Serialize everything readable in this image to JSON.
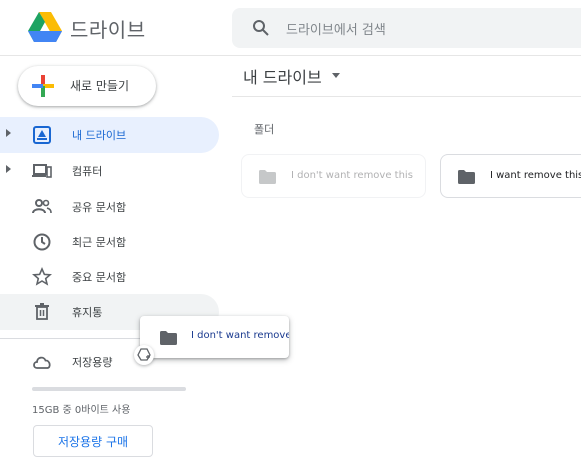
{
  "app": {
    "title": "드라이브"
  },
  "search": {
    "placeholder": "드라이브에서 검색"
  },
  "sidebar": {
    "new_label": "새로 만들기",
    "items": [
      {
        "label": "내 드라이브",
        "icon": "my-drive-icon",
        "active": true,
        "expandable": true
      },
      {
        "label": "컴퓨터",
        "icon": "computer-icon",
        "active": false,
        "expandable": true
      },
      {
        "label": "공유 문서함",
        "icon": "shared-people-icon",
        "active": false
      },
      {
        "label": "최근 문서함",
        "icon": "clock-icon",
        "active": false
      },
      {
        "label": "중요 문서함",
        "icon": "star-icon",
        "active": false
      },
      {
        "label": "휴지통",
        "icon": "trash-icon",
        "active": false,
        "hover": true
      }
    ],
    "storage": {
      "label": "저장용량",
      "usage_text": "15GB 중 0바이트 사용",
      "used_fraction": 0.0,
      "buy_label": "저장용량 구매"
    }
  },
  "main": {
    "title": "내 드라이브",
    "section_label": "폴더",
    "folders": [
      {
        "name": "I don't want remove this",
        "state": "dragging-source"
      },
      {
        "name": "I want remove this",
        "state": "normal"
      }
    ]
  },
  "drag": {
    "name": "I don't want remove"
  },
  "colors": {
    "accent": "#1a73e8",
    "active_bg": "#e8f0fe",
    "folder": "#5f6368"
  }
}
